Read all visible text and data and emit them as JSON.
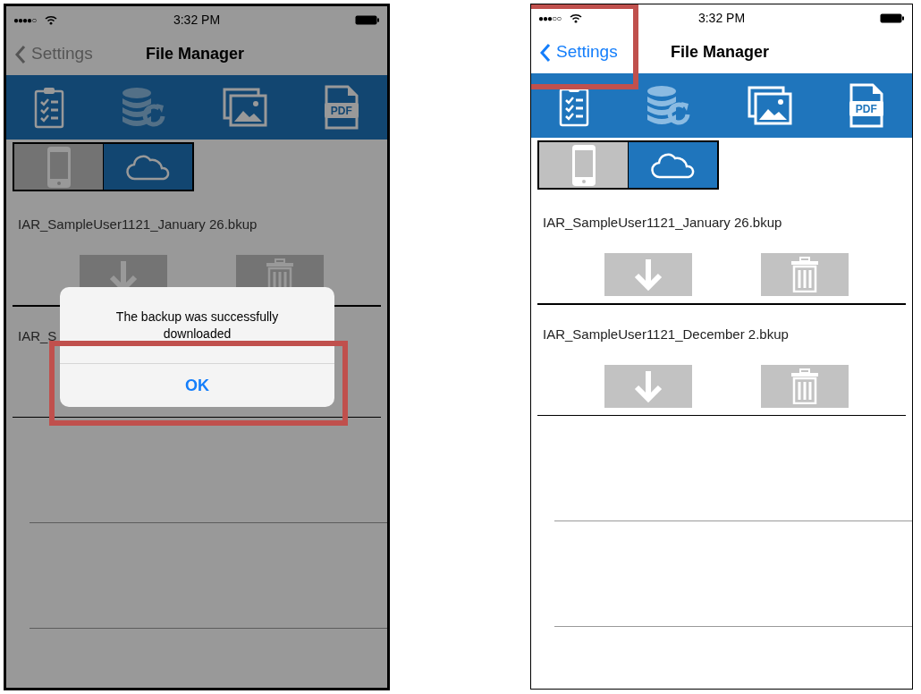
{
  "phones": [
    {
      "bold_frame": true,
      "dimmed": true,
      "status": {
        "signal": "●●●●○",
        "time": "3:32 PM"
      },
      "nav": {
        "back": "Settings",
        "title": "File Manager",
        "highlighted": false
      },
      "toolbar": [
        {
          "kind": "checklist",
          "disabled": false
        },
        {
          "kind": "database_sync",
          "disabled": true
        },
        {
          "kind": "gallery",
          "disabled": false
        },
        {
          "kind": "pdf",
          "label": "PDF",
          "disabled": false
        }
      ],
      "segments": [
        {
          "kind": "device",
          "selected": false
        },
        {
          "kind": "cloud",
          "selected": true
        }
      ],
      "files": [
        {
          "name": "IAR_SampleUser1121_January 26.bkup",
          "buttons_visible": true
        },
        {
          "name": "IAR_S",
          "buttons_visible": false
        }
      ],
      "alert": {
        "message": "The backup was successfully downloaded",
        "button": "OK",
        "highlighted": true
      }
    },
    {
      "bold_frame": false,
      "dimmed": false,
      "status": {
        "signal": "●●●○○",
        "time": "3:32 PM"
      },
      "nav": {
        "back": "Settings",
        "title": "File Manager",
        "highlighted": true
      },
      "toolbar": [
        {
          "kind": "checklist",
          "disabled": false
        },
        {
          "kind": "database_sync",
          "disabled": true
        },
        {
          "kind": "gallery",
          "disabled": false
        },
        {
          "kind": "pdf",
          "label": "PDF",
          "disabled": false
        }
      ],
      "segments": [
        {
          "kind": "device",
          "selected": false
        },
        {
          "kind": "cloud",
          "selected": true
        }
      ],
      "files": [
        {
          "name": "IAR_SampleUser1121_January 26.bkup",
          "buttons_visible": true
        },
        {
          "name": "IAR_SampleUser1121_December 2.bkup",
          "buttons_visible": true
        }
      ]
    }
  ]
}
